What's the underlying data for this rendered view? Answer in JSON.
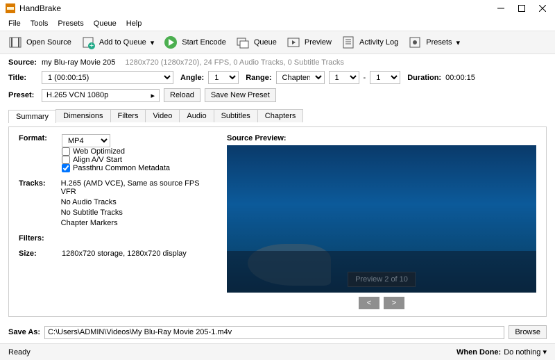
{
  "app": {
    "title": "HandBrake"
  },
  "menu": [
    "File",
    "Tools",
    "Presets",
    "Queue",
    "Help"
  ],
  "toolbar": {
    "open": "Open Source",
    "add": "Add to Queue",
    "start": "Start Encode",
    "queue": "Queue",
    "preview": "Preview",
    "log": "Activity Log",
    "presets": "Presets"
  },
  "source": {
    "label": "Source:",
    "name": "my Blu-ray Movie 205",
    "meta": "1280x720 (1280x720), 24 FPS, 0 Audio Tracks, 0 Subtitle Tracks"
  },
  "title": {
    "label": "Title:",
    "value": "1  (00:00:15)",
    "angleLabel": "Angle:",
    "angle": "1",
    "rangeLabel": "Range:",
    "rangeType": "Chapters",
    "from": "1",
    "dash": "-",
    "to": "1",
    "durLabel": "Duration:",
    "dur": "00:00:15"
  },
  "preset": {
    "label": "Preset:",
    "value": "H.265 VCN 1080p",
    "reload": "Reload",
    "save": "Save New Preset"
  },
  "tabs": [
    "Summary",
    "Dimensions",
    "Filters",
    "Video",
    "Audio",
    "Subtitles",
    "Chapters"
  ],
  "summary": {
    "formatLabel": "Format:",
    "format": "MP4",
    "webopt": "Web Optimized",
    "align": "Align A/V Start",
    "pass": "Passthru Common Metadata",
    "tracksLabel": "Tracks:",
    "tracks": [
      "H.265 (AMD VCE), Same as source FPS VFR",
      "No Audio Tracks",
      "No Subtitle Tracks",
      "Chapter Markers"
    ],
    "filtersLabel": "Filters:",
    "sizeLabel": "Size:",
    "size": "1280x720 storage, 1280x720 display",
    "previewLabel": "Source Preview:",
    "badge": "Preview 2 of 10"
  },
  "save": {
    "label": "Save As:",
    "path": "C:\\Users\\ADMIN\\Videos\\My Blu-Ray Movie 205-1.m4v",
    "browse": "Browse"
  },
  "status": {
    "ready": "Ready",
    "whenLabel": "When Done:",
    "when": "Do nothing"
  }
}
